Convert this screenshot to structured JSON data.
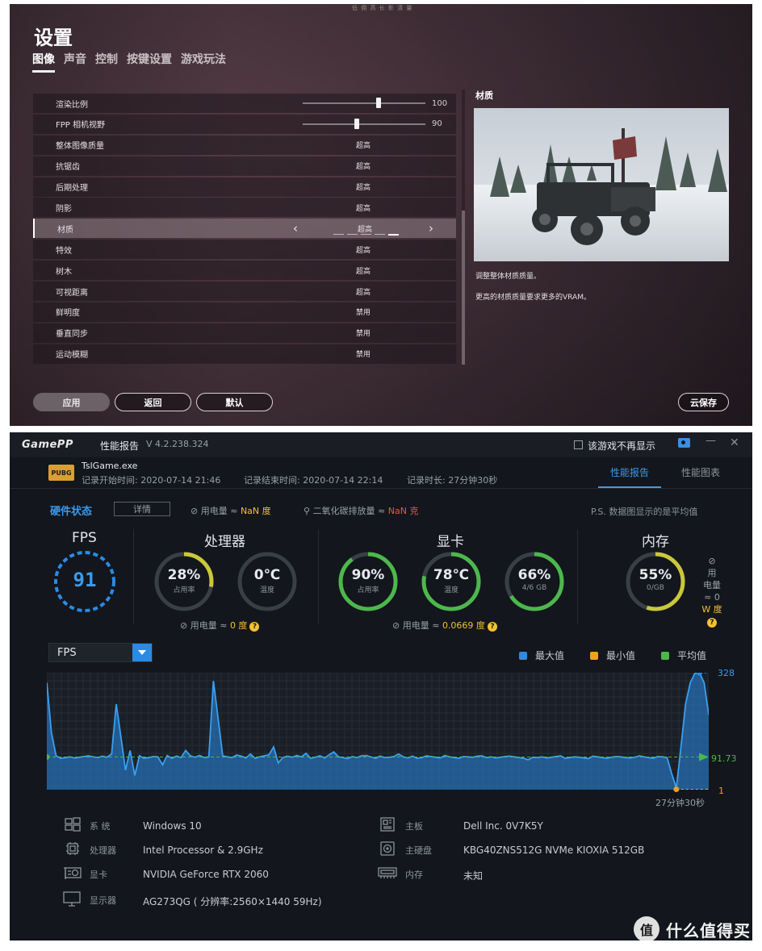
{
  "game_settings": {
    "top_text": "低 佣 高 长 影 清 量",
    "title": "设置",
    "tabs": [
      "图像",
      "声音",
      "控制",
      "按键设置",
      "游戏玩法"
    ],
    "rows": [
      {
        "label": "渲染比例",
        "type": "slider",
        "value": "100",
        "level": 0.62
      },
      {
        "label": "FPP 相机视野",
        "type": "slider",
        "value": "90",
        "level": 0.44
      },
      {
        "label": "整体图像质量",
        "type": "option",
        "value": "超高"
      },
      {
        "label": "抗锯齿",
        "type": "option",
        "value": "超高"
      },
      {
        "label": "后期处理",
        "type": "option",
        "value": "超高"
      },
      {
        "label": "阴影",
        "type": "option",
        "value": "超高"
      },
      {
        "label": "材质",
        "type": "option",
        "value": "超高",
        "selected": true
      },
      {
        "label": "特效",
        "type": "option",
        "value": "超高"
      },
      {
        "label": "树木",
        "type": "option",
        "value": "超高"
      },
      {
        "label": "可视距离",
        "type": "option",
        "value": "超高"
      },
      {
        "label": "鲜明度",
        "type": "option",
        "value": "禁用"
      },
      {
        "label": "垂直同步",
        "type": "option",
        "value": "禁用"
      },
      {
        "label": "运动模糊",
        "type": "option",
        "value": "禁用"
      }
    ],
    "preview_title": "材质",
    "desc1": "调整整体材质质量。",
    "desc2": "更高的材质质量要求更多的VRAM。",
    "buttons": {
      "apply": "应用",
      "back": "返回",
      "default": "默认",
      "cloud": "云保存"
    }
  },
  "gamepp": {
    "logo": "GamePP",
    "report_title": "性能报告",
    "version": "V 4.2.238.324",
    "no_show": "该游戏不再显示",
    "exe": "TslGame.exe",
    "pubg_logo": "PUBG",
    "record_start": "记录开始时间: 2020-07-14 21:46",
    "record_end": "记录结束时间: 2020-07-14 22:14",
    "record_duration": "记录时长: 27分钟30秒",
    "tab_report": "性能报告",
    "tab_chart": "性能图表",
    "hw_status": "硬件状态",
    "detail": "详情",
    "power_label": "用电量 ≈ ",
    "power_value": "NaN 度",
    "co2_label": "二氧化碳排放量 ≈ ",
    "co2_value": "NaN 克",
    "ps_note": "P.S. 数据图显示的是平均值",
    "fps": {
      "title": "FPS",
      "value": "91"
    },
    "cpu": {
      "title": "处理器",
      "usage": "28%",
      "usage_label": "占用率",
      "usage_frac": 0.28,
      "temp": "0℃",
      "temp_label": "温度",
      "temp_frac": 0.0,
      "power_label": "用电量 ≈ ",
      "power": "0 度"
    },
    "gpu": {
      "title": "显卡",
      "usage": "90%",
      "usage_label": "占用率",
      "usage_frac": 0.9,
      "temp": "78℃",
      "temp_label": "温度",
      "temp_frac": 0.78,
      "vram": "66%",
      "vram_label": "4/6 GB",
      "vram_frac": 0.66,
      "power_label": "用电量 ≈ ",
      "power": "0.0669 度"
    },
    "mem": {
      "title": "内存",
      "usage": "55%",
      "usage_label": "0/GB",
      "usage_frac": 0.55,
      "power_line1": "用",
      "power_line2": "电量",
      "power_line3": "≈ 0",
      "power_line4": "W 度"
    },
    "selector": "FPS",
    "legend": {
      "max": "最大值",
      "min": "最小值",
      "avg": "平均值"
    },
    "colors": {
      "accent": "#3a9aed",
      "max": "#2a8be6",
      "min": "#f0a020",
      "avg": "#4cb84c",
      "highlight": "#f2c230"
    },
    "system": {
      "os_label": "系  统",
      "os": "Windows 10",
      "cpu_label": "处理器",
      "cpu": "Intel Processor & 2.9GHz",
      "gpu_label": "显卡",
      "gpu": "NVIDIA GeForce RTX 2060",
      "monitor_label": "显示器",
      "monitor": "AG273QG ( 分辨率:2560×1440 59Hz)",
      "board_label": "主板",
      "board": "Dell Inc. 0V7K5Y",
      "disk_label": "主硬盘",
      "disk": "KBG40ZNS512G NVMe KIOXIA 512GB",
      "ram_label": "内存",
      "ram": "未知"
    },
    "watermark_logo": "值",
    "watermark_text": "什么值得买"
  },
  "chart_data": {
    "type": "area",
    "title": "FPS",
    "xlabel": "27分钟30秒",
    "ylabel": "",
    "ylim": [
      0,
      328
    ],
    "max": 328,
    "min": 1,
    "avg": 91.73,
    "x_end_label": "27分钟30秒",
    "y_tick_labels": [
      "328",
      "91.73",
      "1"
    ],
    "series": [
      {
        "name": "FPS",
        "values": [
          300,
          160,
          95,
          88,
          90,
          92,
          89,
          91,
          93,
          95,
          92,
          90,
          94,
          91,
          100,
          240,
          150,
          55,
          110,
          40,
          95,
          88,
          90,
          93,
          92,
          70,
          96,
          88,
          94,
          90,
          110,
          95,
          91,
          96,
          90,
          92,
          305,
          200,
          95,
          92,
          90,
          97,
          94,
          89,
          100,
          88,
          92,
          95,
          98,
          120,
          75,
          90,
          94,
          91,
          96,
          92,
          102,
          88,
          91,
          95,
          89,
          98,
          106,
          92,
          90,
          87,
          93,
          90,
          95,
          96,
          92,
          88,
          94,
          90,
          91,
          93,
          100,
          92,
          89,
          94,
          88,
          90,
          95,
          93,
          91,
          89,
          96,
          92,
          90,
          88,
          93,
          92,
          91,
          94,
          95,
          90,
          92,
          89,
          91,
          93,
          94,
          92,
          90,
          88,
          84,
          91,
          90,
          92,
          89,
          91,
          93,
          95,
          88,
          90,
          92,
          91,
          89,
          87,
          94,
          92,
          90,
          88,
          91,
          93,
          92,
          90,
          89,
          91,
          95,
          92,
          90,
          88,
          93,
          92,
          90,
          45,
          5,
          120,
          240,
          300,
          326,
          328,
          300,
          210
        ]
      }
    ]
  }
}
